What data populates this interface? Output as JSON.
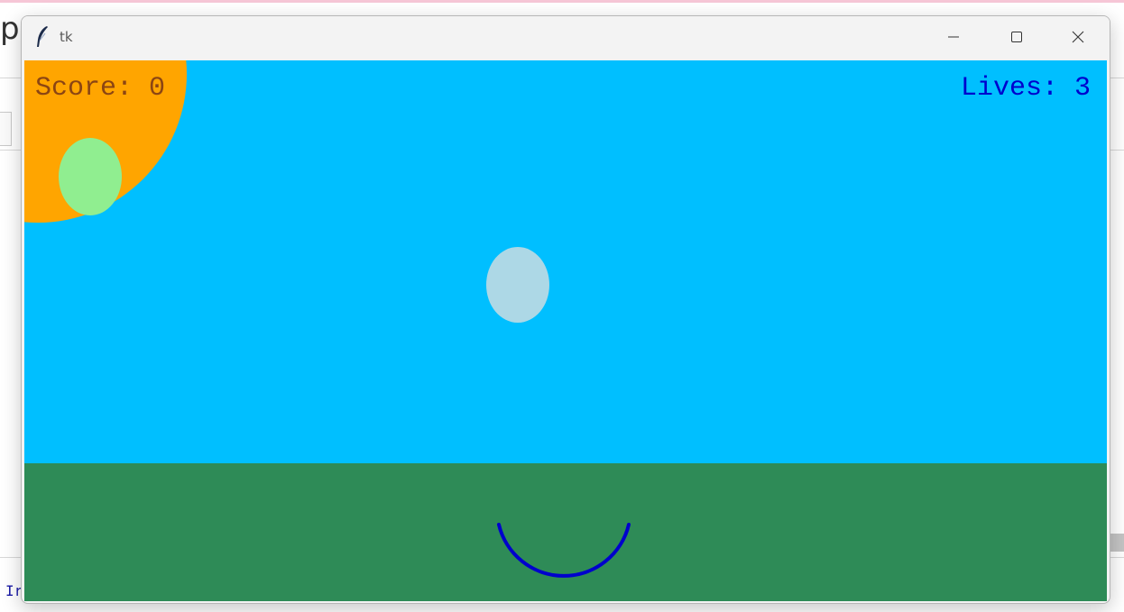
{
  "background_app": {
    "title_fragment": "p",
    "console_fragment": "Ir"
  },
  "window": {
    "title": "tk",
    "icon": "tk-feather-icon",
    "controls": [
      "minimize-icon",
      "maximize-icon",
      "close-icon"
    ]
  },
  "game": {
    "score_label": "Score: 0",
    "lives_label": "Lives: 3",
    "score": 0,
    "lives": 3,
    "colors": {
      "sky": "#00bfff",
      "grass": "#2e8b57",
      "sun": "#ffa500",
      "score_text": "#8b4513",
      "lives_text": "#0000cd",
      "ball_green": "#90ee90",
      "ball_lightblue": "#add8e6",
      "basket": "#0000cd"
    },
    "objects": [
      "sun",
      "falling-ball-green",
      "falling-ball-lightblue",
      "catcher-basket"
    ]
  }
}
